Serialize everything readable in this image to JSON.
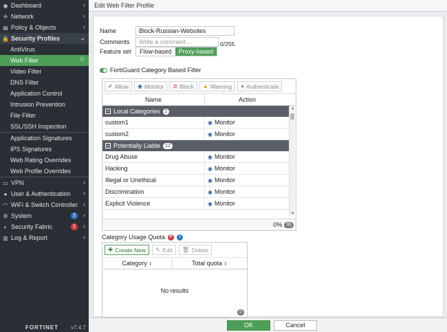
{
  "sidebar": {
    "items": [
      {
        "label": "Dashboard",
        "icon": "dashboard-icon",
        "glyph": "◉",
        "type": "top",
        "chevron": "›"
      },
      {
        "label": "Network",
        "icon": "network-icon",
        "glyph": "✛",
        "type": "top",
        "chevron": "›"
      },
      {
        "label": "Policy & Objects",
        "icon": "policy-icon",
        "glyph": "▤",
        "type": "top",
        "chevron": "›"
      },
      {
        "label": "Security Profiles",
        "icon": "lock-icon",
        "glyph": "🔒",
        "type": "section",
        "chevron": "⌄"
      },
      {
        "label": "AntiVirus",
        "type": "sub"
      },
      {
        "label": "Web Filter",
        "type": "active"
      },
      {
        "label": "Video Filter",
        "type": "sub"
      },
      {
        "label": "DNS Filter",
        "type": "sub"
      },
      {
        "label": "Application Control",
        "type": "sub"
      },
      {
        "label": "Intrusion Prevention",
        "type": "sub"
      },
      {
        "label": "File Filter",
        "type": "sub"
      },
      {
        "label": "SSL/SSH Inspection",
        "type": "sub"
      },
      {
        "label": "Application Signatures",
        "type": "sub"
      },
      {
        "label": "IPS Signatures",
        "type": "sub"
      },
      {
        "label": "Web Rating Overrides",
        "type": "sub"
      },
      {
        "label": "Web Profile Overrides",
        "type": "sub"
      },
      {
        "label": "VPN",
        "icon": "vpn-icon",
        "glyph": "▭",
        "type": "top",
        "chevron": "›"
      },
      {
        "label": "User & Authentication",
        "icon": "user-icon",
        "glyph": "●",
        "type": "top",
        "chevron": "›"
      },
      {
        "label": "WiFi & Switch Controller",
        "icon": "wifi-icon",
        "glyph": "◠",
        "type": "top",
        "chevron": "›"
      },
      {
        "label": "System",
        "icon": "gear-icon",
        "glyph": "⚙",
        "type": "top",
        "chevron": "›",
        "badge": "1",
        "badge_color": "blue"
      },
      {
        "label": "Security Fabric",
        "icon": "fabric-icon",
        "glyph": "◐",
        "type": "top",
        "chevron": "›",
        "badge": "1",
        "badge_color": "red"
      },
      {
        "label": "Log & Report",
        "icon": "report-icon",
        "glyph": "▥",
        "type": "top",
        "chevron": "›"
      }
    ],
    "brand": "FORTINET",
    "version": "v7.4.7"
  },
  "title": "Edit Web Filter Profile",
  "form": {
    "name_label": "Name",
    "name_value": "Block-Russian-Websites",
    "comments_label": "Comments",
    "comments_placeholder": "Write a comment...",
    "comments_counter": "0/255",
    "feature_label": "Feature set",
    "feature_options": [
      "Flow-based",
      "Proxy-based"
    ],
    "feature_selected": "Proxy-based"
  },
  "fortiguard": {
    "label": "FortiGuard Category Based Filter",
    "enabled": true,
    "toolbar": [
      {
        "label": "Allow",
        "glyph": "✔",
        "icon": "check-circle-icon",
        "color": "#4d9f57"
      },
      {
        "label": "Monitor",
        "glyph": "◉",
        "icon": "eye-icon",
        "color": "#2f5f9e"
      },
      {
        "label": "Block",
        "glyph": "⊘",
        "icon": "block-icon",
        "color": "#d23c3c"
      },
      {
        "label": "Warning",
        "glyph": "▲",
        "icon": "warning-icon",
        "color": "#e0a100"
      },
      {
        "label": "Authenticate",
        "glyph": "●",
        "icon": "user-icon",
        "color": "#888"
      }
    ],
    "columns": [
      "Name",
      "Action"
    ],
    "groups": [
      {
        "name": "Local Categories",
        "count": "2",
        "rows": [
          {
            "name": "custom1",
            "action": "Monitor"
          },
          {
            "name": "custom2",
            "action": "Monitor"
          }
        ]
      },
      {
        "name": "Potentially Liable",
        "count": "12",
        "rows": [
          {
            "name": "Drug Abuse",
            "action": "Monitor"
          },
          {
            "name": "Hacking",
            "action": "Monitor"
          },
          {
            "name": "Illegal or Unethical",
            "action": "Monitor"
          },
          {
            "name": "Discrimination",
            "action": "Monitor"
          },
          {
            "name": "Explicit Violence",
            "action": "Monitor"
          }
        ]
      }
    ],
    "footer_pct": "0%",
    "footer_total": "95"
  },
  "quota": {
    "title": "Category Usage Quota",
    "create_label": "Create New",
    "edit_label": "Edit",
    "delete_label": "Delete",
    "columns": [
      "Category",
      "Total quota"
    ],
    "empty_text": "No results",
    "count": "0"
  },
  "buttons": {
    "ok": "OK",
    "cancel": "Cancel"
  }
}
